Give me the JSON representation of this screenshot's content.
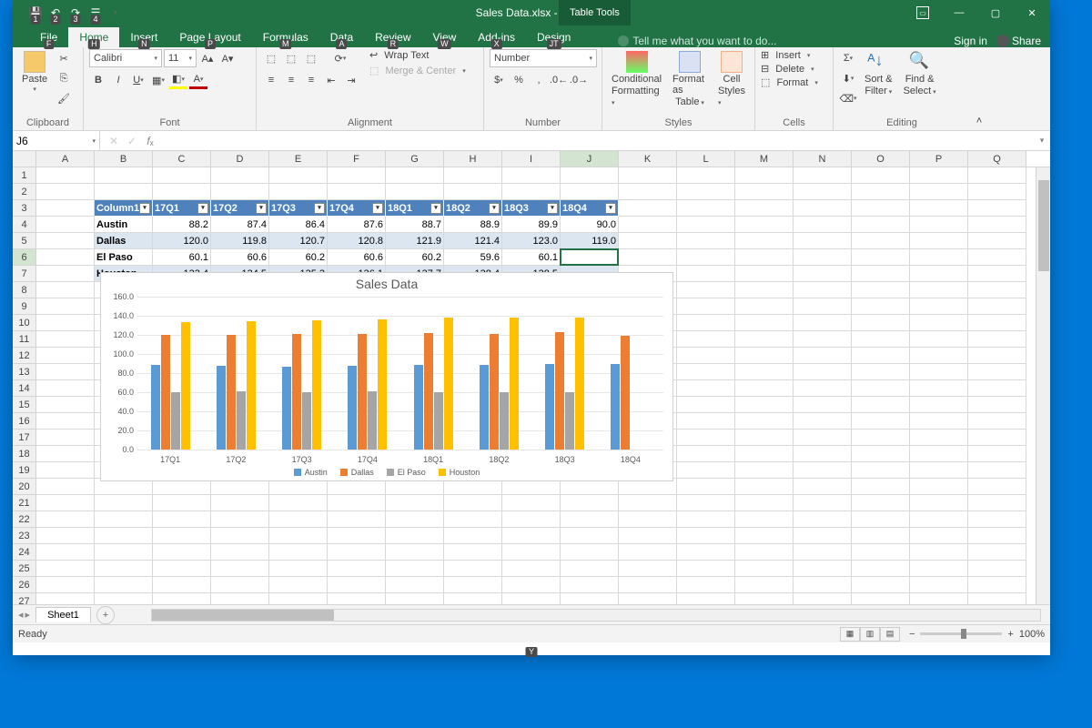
{
  "app": {
    "title": "Sales Data.xlsx - Excel",
    "table_tools": "Table Tools"
  },
  "qat_hints": [
    "1",
    "2",
    "3",
    "4"
  ],
  "tabs": [
    {
      "label": "File",
      "key": "F"
    },
    {
      "label": "Home",
      "key": "H",
      "active": true
    },
    {
      "label": "Insert",
      "key": "N"
    },
    {
      "label": "Page Layout",
      "key": "P"
    },
    {
      "label": "Formulas",
      "key": "M"
    },
    {
      "label": "Data",
      "key": "A"
    },
    {
      "label": "Review",
      "key": "R"
    },
    {
      "label": "View",
      "key": "W"
    },
    {
      "label": "Add-ins",
      "key": "X"
    },
    {
      "label": "Design",
      "key": "JT"
    }
  ],
  "tellme": "Tell me what you want to do...",
  "tellme_key": "Q",
  "signin": "Sign in",
  "share": "Share",
  "share_key": "Y",
  "ribbon": {
    "clipboard": {
      "paste": "Paste",
      "label": "Clipboard"
    },
    "font": {
      "name": "Calibri",
      "size": "11",
      "label": "Font"
    },
    "alignment": {
      "wrap": "Wrap Text",
      "merge": "Merge & Center",
      "label": "Alignment"
    },
    "number": {
      "format": "Number",
      "label": "Number"
    },
    "styles": {
      "cond": "Conditional",
      "cond2": "Formatting",
      "table": "Format as",
      "table2": "Table",
      "cell": "Cell",
      "cell2": "Styles",
      "label": "Styles"
    },
    "cells": {
      "insert": "Insert",
      "delete": "Delete",
      "format": "Format",
      "label": "Cells"
    },
    "editing": {
      "sort": "Sort &",
      "sort2": "Filter",
      "find": "Find &",
      "find2": "Select",
      "label": "Editing"
    }
  },
  "namebox": "J6",
  "columns": [
    "A",
    "B",
    "C",
    "D",
    "E",
    "F",
    "G",
    "H",
    "I",
    "J",
    "K",
    "L",
    "M",
    "N",
    "O",
    "P",
    "Q"
  ],
  "table": {
    "start_row": 3,
    "headers": [
      "Column1",
      "17Q1",
      "17Q2",
      "17Q3",
      "17Q4",
      "18Q1",
      "18Q2",
      "18Q3",
      "18Q4"
    ],
    "rows": [
      {
        "city": "Austin",
        "vals": [
          "88.2",
          "87.4",
          "86.4",
          "87.6",
          "88.7",
          "88.9",
          "89.9",
          "90.0"
        ]
      },
      {
        "city": "Dallas",
        "vals": [
          "120.0",
          "119.8",
          "120.7",
          "120.8",
          "121.9",
          "121.4",
          "123.0",
          "119.0"
        ]
      },
      {
        "city": "El Paso",
        "vals": [
          "60.1",
          "60.6",
          "60.2",
          "60.6",
          "60.2",
          "59.6",
          "60.1",
          ""
        ]
      },
      {
        "city": "Houston",
        "vals": [
          "133.4",
          "134.5",
          "135.3",
          "136.1",
          "137.7",
          "138.4",
          "138.5",
          ""
        ]
      }
    ]
  },
  "chart_data": {
    "type": "bar",
    "title": "Sales Data",
    "categories": [
      "17Q1",
      "17Q2",
      "17Q3",
      "17Q4",
      "18Q1",
      "18Q2",
      "18Q3",
      "18Q4"
    ],
    "series": [
      {
        "name": "Austin",
        "values": [
          88.2,
          87.4,
          86.4,
          87.6,
          88.7,
          88.9,
          89.9,
          90.0
        ]
      },
      {
        "name": "Dallas",
        "values": [
          120.0,
          119.8,
          120.7,
          120.8,
          121.9,
          121.4,
          123.0,
          119.0
        ]
      },
      {
        "name": "El Paso",
        "values": [
          60.1,
          60.6,
          60.2,
          60.6,
          60.2,
          59.6,
          60.1,
          null
        ]
      },
      {
        "name": "Houston",
        "values": [
          133.4,
          134.5,
          135.3,
          136.1,
          137.7,
          138.4,
          138.5,
          null
        ]
      }
    ],
    "ylim": [
      0,
      160
    ],
    "yticks": [
      0,
      20,
      40,
      60,
      80,
      100,
      120,
      140,
      160
    ],
    "ytick_labels": [
      "0.0",
      "20.0",
      "40.0",
      "60.0",
      "80.0",
      "100.0",
      "120.0",
      "140.0",
      "160.0"
    ]
  },
  "sheet": {
    "name": "Sheet1"
  },
  "status": {
    "ready": "Ready",
    "zoom": "100%"
  }
}
